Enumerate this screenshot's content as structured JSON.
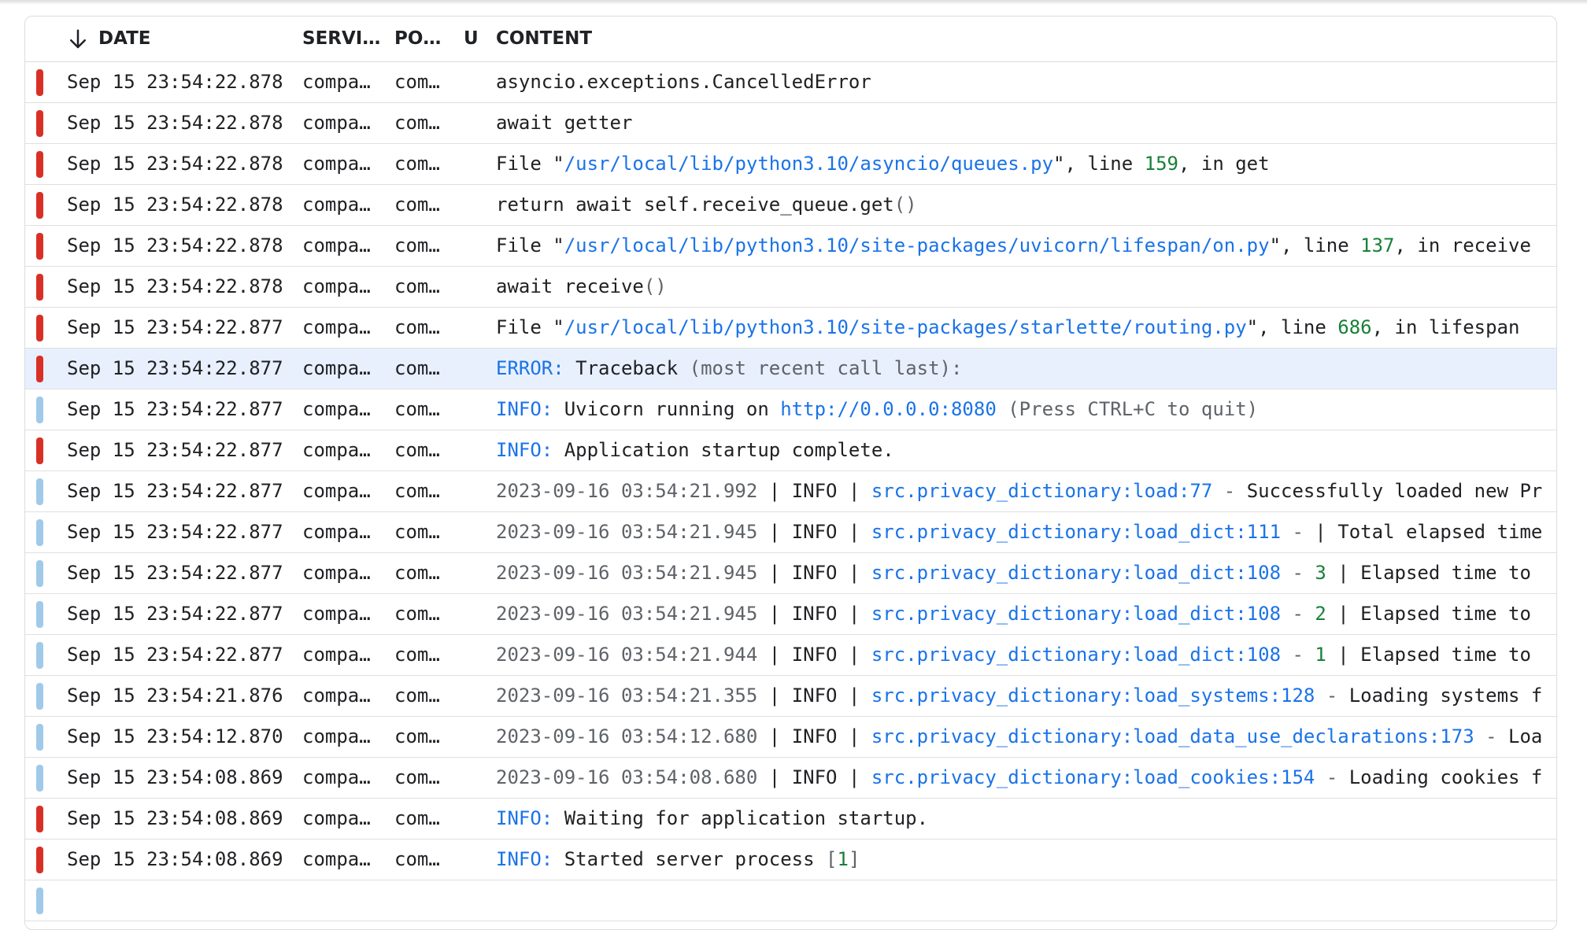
{
  "table": {
    "columns": {
      "date": "DATE",
      "service": "SERVI…",
      "pod": "PO…",
      "u": "U",
      "content": "CONTENT"
    },
    "rows": [
      {
        "severity": "error",
        "date": "Sep 15 23:54:22.878",
        "service": "compa…",
        "pod": "com…",
        "content": [
          {
            "text": "asyncio.exceptions.CancelledError",
            "kind": "text"
          }
        ]
      },
      {
        "severity": "error",
        "date": "Sep 15 23:54:22.878",
        "service": "compa…",
        "pod": "com…",
        "content": [
          {
            "text": "await getter",
            "kind": "text"
          }
        ]
      },
      {
        "severity": "error",
        "date": "Sep 15 23:54:22.878",
        "service": "compa…",
        "pod": "com…",
        "content": [
          {
            "text": "File \"",
            "kind": "text"
          },
          {
            "text": "/usr/local/lib/python3.10/asyncio/queues.py",
            "kind": "path"
          },
          {
            "text": "\", line ",
            "kind": "text"
          },
          {
            "text": "159",
            "kind": "num"
          },
          {
            "text": ", in get",
            "kind": "text"
          }
        ]
      },
      {
        "severity": "error",
        "date": "Sep 15 23:54:22.878",
        "service": "compa…",
        "pod": "com…",
        "content": [
          {
            "text": "return await self.receive_queue.get",
            "kind": "text"
          },
          {
            "text": "()",
            "kind": "muted"
          }
        ]
      },
      {
        "severity": "error",
        "date": "Sep 15 23:54:22.878",
        "service": "compa…",
        "pod": "com…",
        "content": [
          {
            "text": "File \"",
            "kind": "text"
          },
          {
            "text": "/usr/local/lib/python3.10/site-packages/uvicorn/lifespan/on.py",
            "kind": "path"
          },
          {
            "text": "\", line ",
            "kind": "text"
          },
          {
            "text": "137",
            "kind": "num"
          },
          {
            "text": ", in receive",
            "kind": "text"
          }
        ]
      },
      {
        "severity": "error",
        "date": "Sep 15 23:54:22.878",
        "service": "compa…",
        "pod": "com…",
        "content": [
          {
            "text": "await receive",
            "kind": "text"
          },
          {
            "text": "()",
            "kind": "muted"
          }
        ]
      },
      {
        "severity": "error",
        "date": "Sep 15 23:54:22.877",
        "service": "compa…",
        "pod": "com…",
        "content": [
          {
            "text": "File \"",
            "kind": "text"
          },
          {
            "text": "/usr/local/lib/python3.10/site-packages/starlette/routing.py",
            "kind": "path"
          },
          {
            "text": "\", line ",
            "kind": "text"
          },
          {
            "text": "686",
            "kind": "num"
          },
          {
            "text": ", in lifespan",
            "kind": "text"
          }
        ]
      },
      {
        "severity": "error",
        "selected": true,
        "date": "Sep 15 23:54:22.877",
        "service": "compa…",
        "pod": "com…",
        "content": [
          {
            "text": "ERROR:",
            "kind": "level"
          },
          {
            "text": " Traceback ",
            "kind": "text"
          },
          {
            "text": "(most recent call last):",
            "kind": "muted"
          }
        ]
      },
      {
        "severity": "info",
        "date": "Sep 15 23:54:22.877",
        "service": "compa…",
        "pod": "com…",
        "content": [
          {
            "text": "INFO:",
            "kind": "level"
          },
          {
            "text": " Uvicorn running on ",
            "kind": "text"
          },
          {
            "text": "http://0.0.0.0:8080",
            "kind": "link"
          },
          {
            "text": " (Press CTRL+C to quit)",
            "kind": "muted"
          }
        ]
      },
      {
        "severity": "error",
        "date": "Sep 15 23:54:22.877",
        "service": "compa…",
        "pod": "com…",
        "content": [
          {
            "text": "INFO:",
            "kind": "level"
          },
          {
            "text": " Application startup complete.",
            "kind": "text"
          }
        ]
      },
      {
        "severity": "info",
        "date": "Sep 15 23:54:22.877",
        "service": "compa…",
        "pod": "com…",
        "content": [
          {
            "text": "2023-09-16 03:54:21.992",
            "kind": "muted"
          },
          {
            "text": " | INFO | ",
            "kind": "text"
          },
          {
            "text": "src.privacy_dictionary:load:77",
            "kind": "path"
          },
          {
            "text": " - ",
            "kind": "muted"
          },
          {
            "text": "Successfully loaded new Pri…",
            "kind": "text"
          }
        ]
      },
      {
        "severity": "info",
        "date": "Sep 15 23:54:22.877",
        "service": "compa…",
        "pod": "com…",
        "content": [
          {
            "text": "2023-09-16 03:54:21.945",
            "kind": "muted"
          },
          {
            "text": " | INFO | ",
            "kind": "text"
          },
          {
            "text": "src.privacy_dictionary:load_dict:111",
            "kind": "path"
          },
          {
            "text": " - ",
            "kind": "muted"
          },
          {
            "text": "| Total elapsed time …",
            "kind": "text"
          }
        ]
      },
      {
        "severity": "info",
        "date": "Sep 15 23:54:22.877",
        "service": "compa…",
        "pod": "com…",
        "content": [
          {
            "text": "2023-09-16 03:54:21.945",
            "kind": "muted"
          },
          {
            "text": " | INFO | ",
            "kind": "text"
          },
          {
            "text": "src.privacy_dictionary:load_dict:108",
            "kind": "path"
          },
          {
            "text": " - ",
            "kind": "muted"
          },
          {
            "text": "3",
            "kind": "num"
          },
          {
            "text": " | Elapsed time to l…",
            "kind": "text"
          }
        ]
      },
      {
        "severity": "info",
        "date": "Sep 15 23:54:22.877",
        "service": "compa…",
        "pod": "com…",
        "content": [
          {
            "text": "2023-09-16 03:54:21.945",
            "kind": "muted"
          },
          {
            "text": " | INFO | ",
            "kind": "text"
          },
          {
            "text": "src.privacy_dictionary:load_dict:108",
            "kind": "path"
          },
          {
            "text": " - ",
            "kind": "muted"
          },
          {
            "text": "2",
            "kind": "num"
          },
          {
            "text": " | Elapsed time to l…",
            "kind": "text"
          }
        ]
      },
      {
        "severity": "info",
        "date": "Sep 15 23:54:22.877",
        "service": "compa…",
        "pod": "com…",
        "content": [
          {
            "text": "2023-09-16 03:54:21.944",
            "kind": "muted"
          },
          {
            "text": " | INFO | ",
            "kind": "text"
          },
          {
            "text": "src.privacy_dictionary:load_dict:108",
            "kind": "path"
          },
          {
            "text": " - ",
            "kind": "muted"
          },
          {
            "text": "1",
            "kind": "num"
          },
          {
            "text": " | Elapsed time to l…",
            "kind": "text"
          }
        ]
      },
      {
        "severity": "info",
        "date": "Sep 15 23:54:21.876",
        "service": "compa…",
        "pod": "com…",
        "content": [
          {
            "text": "2023-09-16 03:54:21.355",
            "kind": "muted"
          },
          {
            "text": " | INFO | ",
            "kind": "text"
          },
          {
            "text": "src.privacy_dictionary:load_systems:128",
            "kind": "path"
          },
          {
            "text": " - ",
            "kind": "muted"
          },
          {
            "text": "Loading systems fr…",
            "kind": "text"
          }
        ]
      },
      {
        "severity": "info",
        "date": "Sep 15 23:54:12.870",
        "service": "compa…",
        "pod": "com…",
        "content": [
          {
            "text": "2023-09-16 03:54:12.680",
            "kind": "muted"
          },
          {
            "text": " | INFO | ",
            "kind": "text"
          },
          {
            "text": "src.privacy_dictionary:load_data_use_declarations:173",
            "kind": "path"
          },
          {
            "text": " - ",
            "kind": "muted"
          },
          {
            "text": "Load…",
            "kind": "text"
          }
        ]
      },
      {
        "severity": "info",
        "date": "Sep 15 23:54:08.869",
        "service": "compa…",
        "pod": "com…",
        "content": [
          {
            "text": "2023-09-16 03:54:08.680",
            "kind": "muted"
          },
          {
            "text": " | INFO | ",
            "kind": "text"
          },
          {
            "text": "src.privacy_dictionary:load_cookies:154",
            "kind": "path"
          },
          {
            "text": " - ",
            "kind": "muted"
          },
          {
            "text": "Loading cookies fr…",
            "kind": "text"
          }
        ]
      },
      {
        "severity": "error",
        "date": "Sep 15 23:54:08.869",
        "service": "compa…",
        "pod": "com…",
        "content": [
          {
            "text": "INFO:",
            "kind": "level"
          },
          {
            "text": " Waiting for application startup.",
            "kind": "text"
          }
        ]
      },
      {
        "severity": "error",
        "date": "Sep 15 23:54:08.869",
        "service": "compa…",
        "pod": "com…",
        "content": [
          {
            "text": "INFO:",
            "kind": "level"
          },
          {
            "text": " Started server process ",
            "kind": "text"
          },
          {
            "text": "[",
            "kind": "muted"
          },
          {
            "text": "1",
            "kind": "num"
          },
          {
            "text": "]",
            "kind": "muted"
          }
        ]
      },
      {
        "severity": "info",
        "date": "",
        "service": "",
        "pod": "",
        "content": []
      }
    ]
  },
  "colors": {
    "error": "#d93025",
    "info": "#a1c9e9",
    "link": "#1a73e8",
    "number": "#188038",
    "selected_row": "#e8f0fe"
  },
  "icons": {
    "sort": "arrow-down-icon"
  }
}
